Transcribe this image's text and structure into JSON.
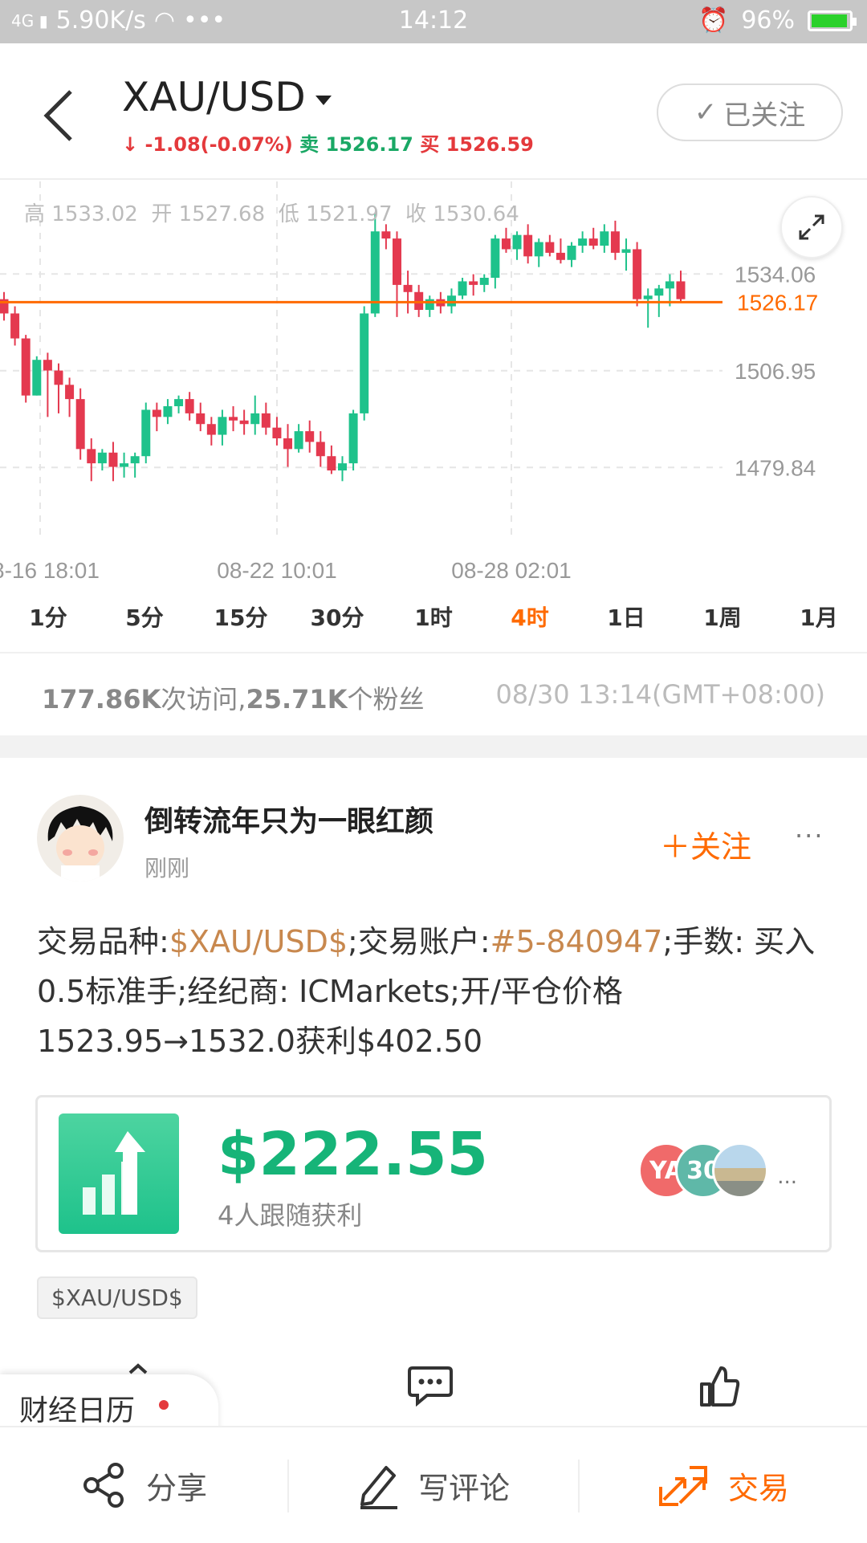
{
  "status_bar": {
    "network": "4G",
    "speed": "5.90K/s",
    "dots": "•••",
    "time": "14:12",
    "battery": "96%"
  },
  "header": {
    "title": "XAU/USD",
    "change_arrow": "↓",
    "change": "-1.08(-0.07%)",
    "sell_label": "卖",
    "sell_price": "1526.17",
    "buy_label": "买",
    "buy_price": "1526.59",
    "follow_label": "已关注"
  },
  "chart_data": {
    "type": "candlestick",
    "ohlc_summary": {
      "high_label": "高",
      "high": "1533.02",
      "open_label": "开",
      "open": "1527.68",
      "low_label": "低",
      "low": "1521.97",
      "close_label": "收",
      "close": "1530.64"
    },
    "y_ticks": [
      "1534.06",
      "1506.95",
      "1479.84"
    ],
    "current_price": "1526.17",
    "x_ticks": [
      "8-16 18:01",
      "08-22 10:01",
      "08-28 02:01"
    ],
    "ylim": [
      1470,
      1560
    ],
    "colors": {
      "up": "#1ec28b",
      "down": "#e4394f",
      "current_line": "#ff6a00"
    },
    "candles": [
      [
        1527,
        1529,
        1521,
        1523
      ],
      [
        1523,
        1525,
        1514,
        1516
      ],
      [
        1516,
        1517,
        1498,
        1500
      ],
      [
        1500,
        1511,
        1500,
        1510
      ],
      [
        1510,
        1512,
        1494,
        1507
      ],
      [
        1507,
        1509,
        1495,
        1503
      ],
      [
        1503,
        1505,
        1494,
        1499
      ],
      [
        1499,
        1502,
        1482,
        1485
      ],
      [
        1485,
        1488,
        1476,
        1481
      ],
      [
        1481,
        1485,
        1479,
        1484
      ],
      [
        1484,
        1487,
        1476,
        1480
      ],
      [
        1480,
        1484,
        1477,
        1481
      ],
      [
        1481,
        1484,
        1477,
        1483
      ],
      [
        1483,
        1498,
        1481,
        1496
      ],
      [
        1496,
        1498,
        1490,
        1494
      ],
      [
        1494,
        1499,
        1492,
        1497
      ],
      [
        1497,
        1500,
        1495,
        1499
      ],
      [
        1499,
        1501,
        1493,
        1495
      ],
      [
        1495,
        1498,
        1490,
        1492
      ],
      [
        1492,
        1494,
        1486,
        1489
      ],
      [
        1489,
        1496,
        1486,
        1494
      ],
      [
        1494,
        1497,
        1490,
        1493
      ],
      [
        1493,
        1496,
        1489,
        1492
      ],
      [
        1492,
        1500,
        1489,
        1495
      ],
      [
        1495,
        1498,
        1489,
        1491
      ],
      [
        1491,
        1494,
        1486,
        1488
      ],
      [
        1488,
        1492,
        1480,
        1485
      ],
      [
        1485,
        1492,
        1484,
        1490
      ],
      [
        1490,
        1493,
        1484,
        1487
      ],
      [
        1487,
        1490,
        1480,
        1483
      ],
      [
        1483,
        1486,
        1478,
        1479
      ],
      [
        1479,
        1483,
        1476,
        1481
      ],
      [
        1481,
        1496,
        1479,
        1495
      ],
      [
        1495,
        1525,
        1493,
        1523
      ],
      [
        1523,
        1551,
        1522,
        1546
      ],
      [
        1546,
        1548,
        1541,
        1544
      ],
      [
        1544,
        1546,
        1522,
        1531
      ],
      [
        1531,
        1535,
        1523,
        1529
      ],
      [
        1529,
        1531,
        1522,
        1524
      ],
      [
        1524,
        1528,
        1522,
        1527
      ],
      [
        1527,
        1529,
        1523,
        1525
      ],
      [
        1525,
        1530,
        1523,
        1528
      ],
      [
        1528,
        1533,
        1527,
        1532
      ],
      [
        1532,
        1534,
        1528,
        1531
      ],
      [
        1531,
        1534,
        1529,
        1533
      ],
      [
        1533,
        1545,
        1530,
        1544
      ],
      [
        1544,
        1547,
        1540,
        1541
      ],
      [
        1541,
        1546,
        1538,
        1545
      ],
      [
        1545,
        1548,
        1537,
        1539
      ],
      [
        1539,
        1544,
        1536,
        1543
      ],
      [
        1543,
        1545,
        1539,
        1540
      ],
      [
        1540,
        1544,
        1537,
        1538
      ],
      [
        1538,
        1543,
        1536,
        1542
      ],
      [
        1542,
        1546,
        1540,
        1544
      ],
      [
        1544,
        1547,
        1541,
        1542
      ],
      [
        1542,
        1548,
        1540,
        1546
      ],
      [
        1546,
        1549,
        1538,
        1540
      ],
      [
        1540,
        1544,
        1535,
        1541
      ],
      [
        1541,
        1543,
        1525,
        1527
      ],
      [
        1527,
        1530,
        1519,
        1528
      ],
      [
        1528,
        1531,
        1522,
        1530
      ],
      [
        1530,
        1534,
        1525,
        1532
      ],
      [
        1532,
        1535,
        1526,
        1527
      ]
    ]
  },
  "periods": {
    "items": [
      "1分",
      "5分",
      "15分",
      "30分",
      "1时",
      "4时",
      "1日",
      "1周",
      "1月"
    ],
    "active": "4时"
  },
  "stats": {
    "visits_num": "177.86K",
    "visits_label": "次访问,",
    "fans_num": "25.71K",
    "fans_label": "个粉丝",
    "timestamp": "08/30 13:14(GMT+08:00)"
  },
  "post": {
    "author": "倒转流年只为一眼红颜",
    "time_ago": "刚刚",
    "follow_label": "关注",
    "more": "···",
    "text_prefix": "交易品种:",
    "symbol": "$XAU/USD$",
    "text_account": ";交易账户:",
    "account": "#5-840947",
    "text_rest": ";手数: 买入 0.5标准手;经纪商: ICMarkets;开/平仓价格1523.95→1532.0获利$402.50",
    "profit_amount": "$222.55",
    "profit_sub": "4人跟随获利",
    "follower_avatars": [
      "YA",
      "30",
      ""
    ],
    "card_more": "...",
    "symbol_tag": "$XAU/USD$"
  },
  "bottom": {
    "calendar_label": "财经日历",
    "share_label": "分享",
    "comment_label": "写评论",
    "trade_label": "交易"
  }
}
